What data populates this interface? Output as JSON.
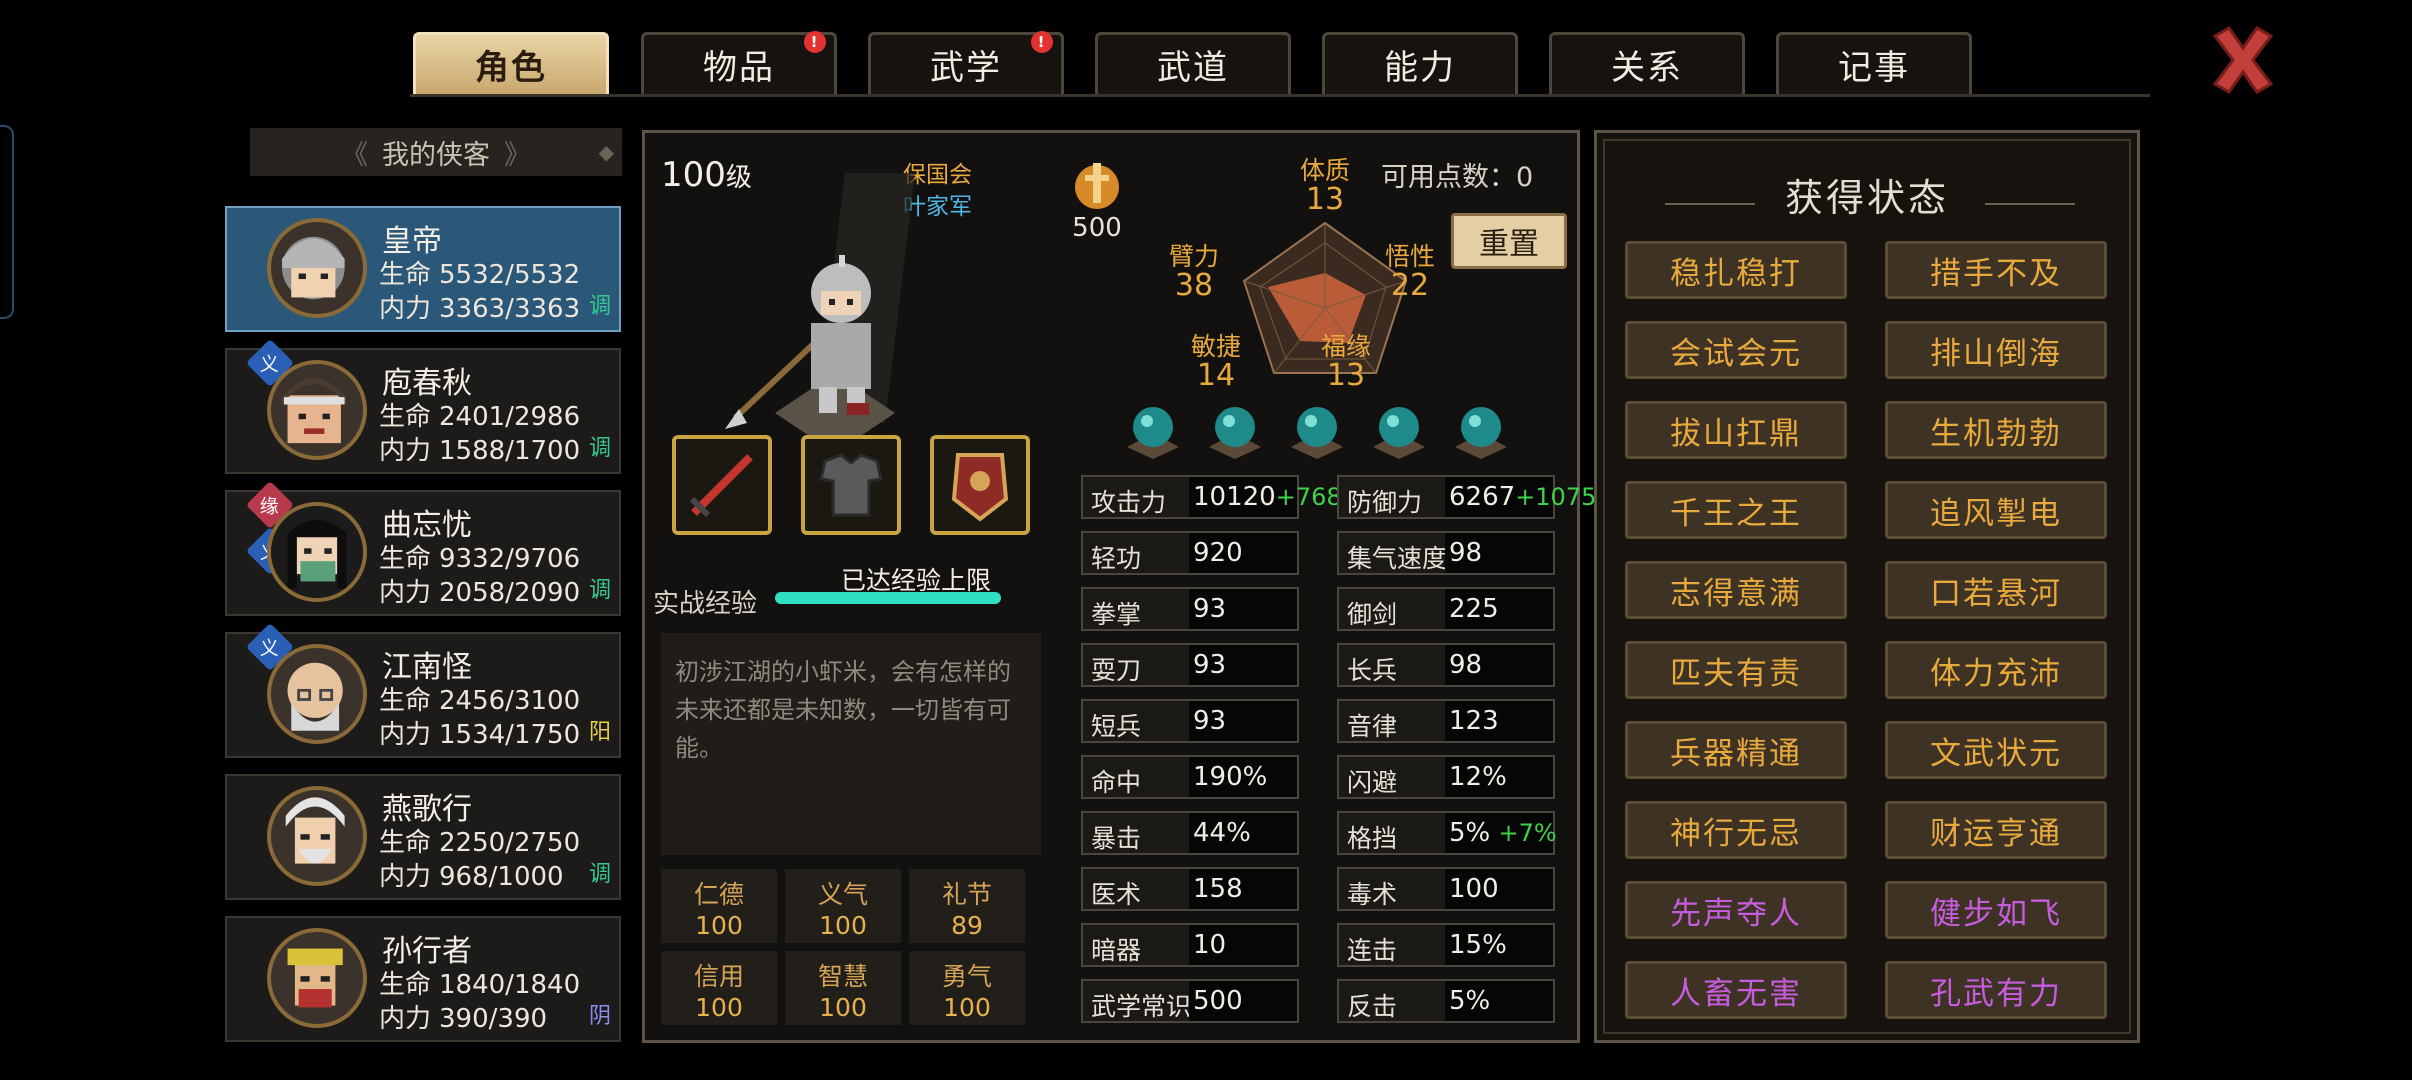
{
  "tabs": [
    {
      "label": "角色",
      "active": true,
      "alert": false
    },
    {
      "label": "物品",
      "active": false,
      "alert": true
    },
    {
      "label": "武学",
      "active": false,
      "alert": true
    },
    {
      "label": "武道",
      "active": false,
      "alert": false
    },
    {
      "label": "能力",
      "active": false,
      "alert": false
    },
    {
      "label": "关系",
      "active": false,
      "alert": false
    },
    {
      "label": "记事",
      "active": false,
      "alert": false
    }
  ],
  "alert_mark": "!",
  "close_icon": "close-x-icon",
  "roster": {
    "title": "我的侠客",
    "hp_label": "生命",
    "mp_label": "内力",
    "heroes": [
      {
        "name": "皇帝",
        "hp": "5532/5532",
        "mp": "3363/3363",
        "tag": "调",
        "tag_color": "#35c98f",
        "badges": []
      },
      {
        "name": "庖春秋",
        "hp": "2401/2986",
        "mp": "1588/1700",
        "tag": "调",
        "tag_color": "#35c98f",
        "badges": [
          "义"
        ]
      },
      {
        "name": "曲忘忧",
        "hp": "9332/9706",
        "mp": "2058/2090",
        "tag": "调",
        "tag_color": "#35c98f",
        "badges": [
          "缘",
          "义"
        ]
      },
      {
        "name": "江南怪",
        "hp": "2456/3100",
        "mp": "1534/1750",
        "tag": "阳",
        "tag_color": "#e8d24a",
        "badges": [
          "义"
        ]
      },
      {
        "name": "燕歌行",
        "hp": "2250/2750",
        "mp": "968/1000",
        "tag": "调",
        "tag_color": "#35c98f",
        "badges": []
      },
      {
        "name": "孙行者",
        "hp": "1840/1840",
        "mp": "390/390",
        "tag": "阴",
        "tag_color": "#8a8ef0",
        "badges": []
      }
    ]
  },
  "character": {
    "level": "100",
    "level_unit": "级",
    "faction": "保国会",
    "title": "叶家军",
    "reputation": "500",
    "exp_label": "实战经验",
    "exp_status": "已达经验上限",
    "exp_progress": 1.0,
    "description": "初涉江湖的小虾米，会有怎样的未来还都是未知数，一切皆有可能。",
    "virtues": [
      {
        "label": "仁德",
        "value": "100"
      },
      {
        "label": "义气",
        "value": "100"
      },
      {
        "label": "礼节",
        "value": "89"
      },
      {
        "label": "信用",
        "value": "100"
      },
      {
        "label": "智慧",
        "value": "100"
      },
      {
        "label": "勇气",
        "value": "100"
      }
    ]
  },
  "attributes": {
    "points_label": "可用点数：",
    "points_value": "0",
    "reset_label": "重置",
    "radar": [
      {
        "label": "体质",
        "value": "13"
      },
      {
        "label": "悟性",
        "value": "22"
      },
      {
        "label": "福缘",
        "value": "13"
      },
      {
        "label": "敏捷",
        "value": "14"
      },
      {
        "label": "臂力",
        "value": "38"
      }
    ],
    "orb_count": 5
  },
  "stats": [
    {
      "label": "攻击力",
      "value": "10120",
      "bonus": "+768"
    },
    {
      "label": "防御力",
      "value": "6267",
      "bonus": "+1075"
    },
    {
      "label": "轻功",
      "value": "920",
      "bonus": ""
    },
    {
      "label": "集气速度",
      "value": "98",
      "bonus": ""
    },
    {
      "label": "拳掌",
      "value": "93",
      "bonus": ""
    },
    {
      "label": "御剑",
      "value": "225",
      "bonus": ""
    },
    {
      "label": "耍刀",
      "value": "93",
      "bonus": ""
    },
    {
      "label": "长兵",
      "value": "98",
      "bonus": ""
    },
    {
      "label": "短兵",
      "value": "93",
      "bonus": ""
    },
    {
      "label": "音律",
      "value": "123",
      "bonus": ""
    },
    {
      "label": "命中",
      "value": "190%",
      "bonus": ""
    },
    {
      "label": "闪避",
      "value": "12%",
      "bonus": ""
    },
    {
      "label": "暴击",
      "value": "44%",
      "bonus": ""
    },
    {
      "label": "格挡",
      "value": "5%",
      "bonus": "+7%"
    },
    {
      "label": "医术",
      "value": "158",
      "bonus": ""
    },
    {
      "label": "毒术",
      "value": "100",
      "bonus": ""
    },
    {
      "label": "暗器",
      "value": "10",
      "bonus": ""
    },
    {
      "label": "连击",
      "value": "15%",
      "bonus": ""
    },
    {
      "label": "武学常识",
      "value": "500",
      "bonus": ""
    },
    {
      "label": "反击",
      "value": "5%",
      "bonus": ""
    }
  ],
  "status_panel": {
    "title": "获得状态",
    "items": [
      {
        "label": "稳扎稳打",
        "color": "orange"
      },
      {
        "label": "措手不及",
        "color": "orange"
      },
      {
        "label": "会试会元",
        "color": "orange"
      },
      {
        "label": "排山倒海",
        "color": "orange"
      },
      {
        "label": "拔山扛鼎",
        "color": "orange"
      },
      {
        "label": "生机勃勃",
        "color": "orange"
      },
      {
        "label": "千王之王",
        "color": "orange"
      },
      {
        "label": "追风掣电",
        "color": "orange"
      },
      {
        "label": "志得意满",
        "color": "orange"
      },
      {
        "label": "口若悬河",
        "color": "orange"
      },
      {
        "label": "匹夫有责",
        "color": "orange"
      },
      {
        "label": "体力充沛",
        "color": "orange"
      },
      {
        "label": "兵器精通",
        "color": "orange"
      },
      {
        "label": "文武状元",
        "color": "orange"
      },
      {
        "label": "神行无忌",
        "color": "orange"
      },
      {
        "label": "财运亨通",
        "color": "orange"
      },
      {
        "label": "先声夺人",
        "color": "purple"
      },
      {
        "label": "健步如飞",
        "color": "purple"
      },
      {
        "label": "人畜无害",
        "color": "purple"
      },
      {
        "label": "孔武有力",
        "color": "purple"
      }
    ]
  },
  "colors": {
    "accent_gold": "#e8a93d",
    "rare_purple": "#c75dde",
    "bonus_green": "#3fd24a",
    "selected_blue": "#2b5878"
  }
}
